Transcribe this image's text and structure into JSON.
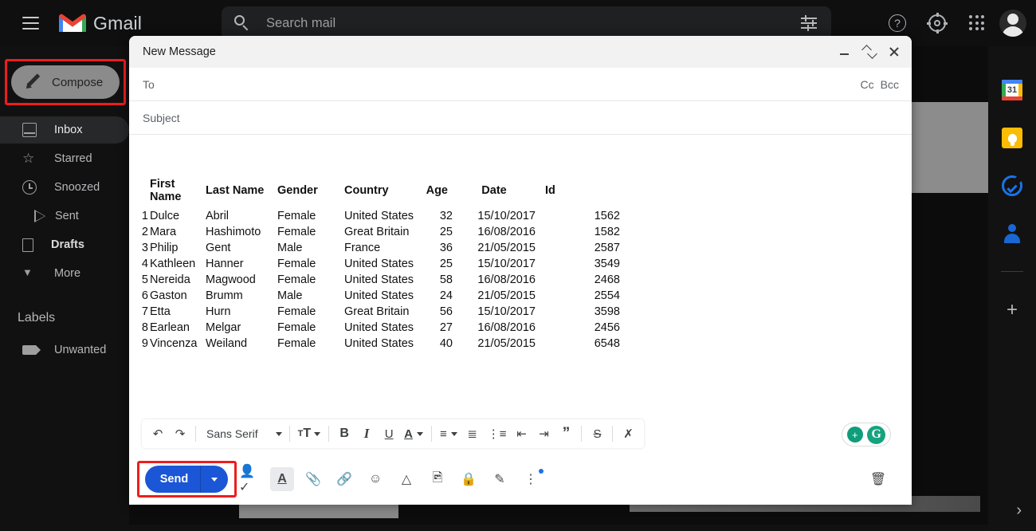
{
  "app": {
    "brand": "Gmail",
    "logo_icon": "gmail-m-logo"
  },
  "search": {
    "placeholder": "Search mail",
    "icon": "search-icon",
    "filter_icon": "tune-filter-icon"
  },
  "top_right": {
    "help_label": "?",
    "help_icon": "help-circle-icon",
    "settings_icon": "gear-icon",
    "apps_icon": "google-apps-grid-icon",
    "avatar_icon": "account-avatar"
  },
  "sidebar": {
    "compose": {
      "label": "Compose",
      "icon": "pencil-icon",
      "highlighted": true
    },
    "items": [
      {
        "label": "Inbox",
        "icon": "inbox-icon",
        "active": true,
        "bold": false
      },
      {
        "label": "Starred",
        "icon": "star-icon",
        "active": false,
        "bold": false
      },
      {
        "label": "Snoozed",
        "icon": "clock-icon",
        "active": false,
        "bold": false
      },
      {
        "label": "Sent",
        "icon": "send-arrow-icon",
        "active": false,
        "bold": false
      },
      {
        "label": "Drafts",
        "icon": "document-icon",
        "active": false,
        "bold": true
      },
      {
        "label": "More",
        "icon": "chevron-down-icon",
        "active": false,
        "bold": false
      }
    ],
    "labels_heading": "Labels",
    "labels": [
      {
        "label": "Unwanted",
        "icon": "label-tag-icon"
      }
    ]
  },
  "background_pane": {
    "prev_icon": "chevron-left-icon",
    "next_icon": "chevron-right-icon",
    "print_icon": "print-icon",
    "popout_icon": "open-in-new-icon",
    "reply_icon": "reply-arrow-icon",
    "more_icon": "more-vertical-icon"
  },
  "right_rail": {
    "items": [
      {
        "name": "calendar",
        "icon": "google-calendar-icon",
        "badge": "31"
      },
      {
        "name": "keep",
        "icon": "google-keep-icon",
        "badge": ""
      },
      {
        "name": "tasks",
        "icon": "google-tasks-icon",
        "badge": ""
      },
      {
        "name": "contacts",
        "icon": "google-contacts-icon",
        "badge": ""
      }
    ],
    "add_label": "+",
    "add_icon": "plus-icon",
    "expand_icon": "chevron-right-icon"
  },
  "compose_window": {
    "title": "New Message",
    "minimize_icon": "minimize-icon",
    "collapse_icon": "collapse-arrows-icon",
    "close_icon": "close-icon",
    "to_label": "To",
    "to_value": "",
    "cc_label": "Cc",
    "bcc_label": "Bcc",
    "subject_placeholder": "Subject",
    "subject_value": ""
  },
  "body_table": {
    "headers": [
      "",
      "First Name",
      "Last Name",
      "Gender",
      "Country",
      "Age",
      "Date",
      "Id"
    ],
    "rows": [
      [
        "1",
        "Dulce",
        "Abril",
        "Female",
        "United States",
        "32",
        "15/10/2017",
        "1562"
      ],
      [
        "2",
        "Mara",
        "Hashimoto",
        "Female",
        "Great Britain",
        "25",
        "16/08/2016",
        "1582"
      ],
      [
        "3",
        "Philip",
        "Gent",
        "Male",
        "France",
        "36",
        "21/05/2015",
        "2587"
      ],
      [
        "4",
        "Kathleen",
        "Hanner",
        "Female",
        "United States",
        "25",
        "15/10/2017",
        "3549"
      ],
      [
        "5",
        "Nereida",
        "Magwood",
        "Female",
        "United States",
        "58",
        "16/08/2016",
        "2468"
      ],
      [
        "6",
        "Gaston",
        "Brumm",
        "Male",
        "United States",
        "24",
        "21/05/2015",
        "2554"
      ],
      [
        "7",
        "Etta",
        "Hurn",
        "Female",
        "Great Britain",
        "56",
        "15/10/2017",
        "3598"
      ],
      [
        "8",
        "Earlean",
        "Melgar",
        "Female",
        "United States",
        "27",
        "16/08/2016",
        "2456"
      ],
      [
        "9",
        "Vincenza",
        "Weiland",
        "Female",
        "United States",
        "40",
        "21/05/2015",
        "6548"
      ]
    ]
  },
  "format_toolbar": {
    "undo_icon": "undo-icon",
    "redo_icon": "redo-icon",
    "font_name": "Sans Serif",
    "font_size_icon": "font-size-icon",
    "bold_label": "B",
    "italic_label": "I",
    "underline_label": "U",
    "text_color_label": "A",
    "align_icon": "align-left-icon",
    "numbered_list_icon": "numbered-list-icon",
    "bulleted_list_icon": "bulleted-list-icon",
    "indent_less_icon": "indent-decrease-icon",
    "indent_more_icon": "indent-increase-icon",
    "quote_label": "”",
    "strikethrough_label": "S",
    "remove_format_icon": "remove-formatting-icon"
  },
  "grammarly": {
    "assistant_icon": "grammarly-suggestion-icon",
    "logo_label": "G",
    "logo_icon": "grammarly-logo-icon"
  },
  "action_row": {
    "send_label": "Send",
    "send_options_icon": "chevron-down-icon",
    "send_highlighted": true,
    "buttons": [
      {
        "name": "schedule-send",
        "icon": "person-check-icon",
        "selected": false
      },
      {
        "name": "formatting",
        "icon": "format-text-icon",
        "selected": true
      },
      {
        "name": "attach-file",
        "icon": "paperclip-icon",
        "selected": false
      },
      {
        "name": "insert-link",
        "icon": "link-icon",
        "selected": false
      },
      {
        "name": "insert-emoji",
        "icon": "emoji-smile-icon",
        "selected": false
      },
      {
        "name": "insert-drive",
        "icon": "google-drive-icon",
        "selected": false
      },
      {
        "name": "insert-photo",
        "icon": "image-icon",
        "selected": false
      },
      {
        "name": "confidential",
        "icon": "lock-clock-icon",
        "selected": false
      },
      {
        "name": "insert-signature",
        "icon": "pen-icon",
        "selected": false
      },
      {
        "name": "more-options",
        "icon": "more-vertical-icon",
        "selected": false
      }
    ],
    "discard_icon": "trash-icon"
  },
  "colors": {
    "send_blue": "#1a56d6",
    "highlight_red": "#ee1d1d",
    "grammarly_green": "#15a37f",
    "dark_bg": "#111112"
  }
}
